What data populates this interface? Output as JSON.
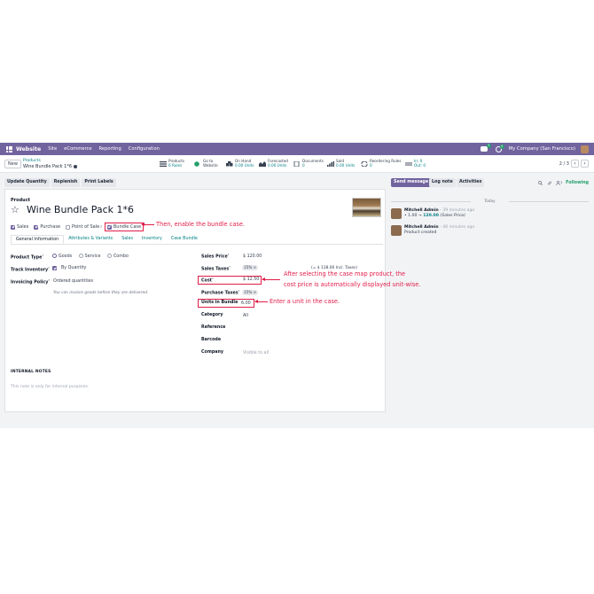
{
  "topnav": {
    "app_name": "Website",
    "menu": [
      "Site",
      "eCommerce",
      "Reporting",
      "Configuration"
    ],
    "chat_badge": "3",
    "clock_badge": "9",
    "company": "My Company (San Francisco)"
  },
  "control": {
    "new_label": "New",
    "breadcrumb_parent": "Products",
    "breadcrumb_current": "Wine Bundle Pack 1*6",
    "smart_buttons": [
      {
        "l1": "Products",
        "l2": "6 Rules"
      },
      {
        "l1": "Go to",
        "l2": "Website"
      },
      {
        "l1": "On Hand",
        "l2": "0.00 Units"
      },
      {
        "l1": "Forecasted",
        "l2": "0.00 Units"
      },
      {
        "l1": "Documents",
        "l2": "0"
      },
      {
        "l1": "Sold",
        "l2": "0.00 Units"
      },
      {
        "l1": "Reordering Rules",
        "l2": "0"
      },
      {
        "l1": "In: 0",
        "l2": "Out: 0"
      }
    ],
    "pager": "2 / 3"
  },
  "actions": [
    "Update Quantity",
    "Replenish",
    "Print Labels"
  ],
  "form": {
    "product_label": "Product",
    "product_name": "Wine Bundle Pack 1*6",
    "checkboxes": {
      "sales": "Sales",
      "purchase": "Purchase",
      "pos": "Point of Sale",
      "bundle": "Bundle Case"
    },
    "tabs": [
      "General Information",
      "Attributes & Variants",
      "Sales",
      "Inventory",
      "Case Bundle"
    ],
    "left": {
      "product_type_label": "Product Type",
      "goods": "Goods",
      "service": "Service",
      "combo": "Combo",
      "track_inventory_label": "Track Inventory",
      "by_quantity": "By Quantity",
      "invoicing_policy_label": "Invoicing Policy",
      "invoicing_policy_value": "Ordered quantities",
      "invoicing_help": "You can invoice goods before they are delivered."
    },
    "right": {
      "sales_price_label": "Sales Price",
      "sales_price": "$ 120.00",
      "sales_taxes_label": "Sales Taxes",
      "sales_tax_tag": "15%",
      "incl_taxes": "(= $ 138.00 Incl. Taxes)",
      "cost_label": "Cost",
      "cost": "$ 12.50",
      "purchase_taxes_label": "Purchase Taxes",
      "purchase_tax_tag": "15%",
      "units_label": "Units in Bundle",
      "units": "6.00",
      "category_label": "Category",
      "category": "All",
      "reference_label": "Reference",
      "barcode_label": "Barcode",
      "company_label": "Company",
      "company_placeholder": "Visible to all"
    },
    "internal_notes_label": "INTERNAL NOTES",
    "notes_placeholder": "This note is only for internal purposes."
  },
  "annotations": {
    "bundle": "Then, enable the bundle case.",
    "cost_l1": "After selecting the case map product, the",
    "cost_l2": "cost price is automatically displayed unit-wise.",
    "units": "Enter a unit in the case."
  },
  "chatter": {
    "send_message": "Send message",
    "log_note": "Log note",
    "activities": "Activities",
    "followers_count": "1",
    "following": "Following",
    "today": "Today",
    "messages": [
      {
        "author": "Mitchell Admin",
        "time": "- 39 minutes ago",
        "old": "1.00",
        "arrow": "→",
        "new": "120.00",
        "field": "(Sales Price)"
      },
      {
        "author": "Mitchell Admin",
        "time": "- 46 minutes ago",
        "body": "Product created"
      }
    ]
  },
  "colors": {
    "brand": "#71639e",
    "link": "#017e84",
    "annotation": "#e11d48",
    "following": "#22a06b"
  }
}
